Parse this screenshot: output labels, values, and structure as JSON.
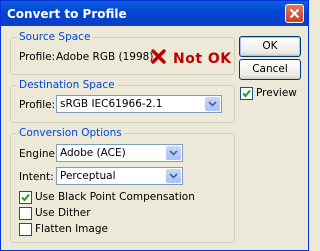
{
  "window": {
    "title": "Convert to Profile"
  },
  "source_space": {
    "legend": "Source Space",
    "profile_label": "Profile:",
    "profile_value": "Adobe RGB (1998)",
    "annotation": "Not OK",
    "annotation_icon": "x-mark-icon",
    "annotation_color": "#c00000"
  },
  "destination_space": {
    "legend": "Destination Space",
    "profile_label": "Profile:",
    "profile_value": "sRGB IEC61966-2.1"
  },
  "conversion_options": {
    "legend": "Conversion Options",
    "engine_label": "Engine:",
    "engine_value": "Adobe (ACE)",
    "intent_label": "Intent:",
    "intent_value": "Perceptual",
    "checkboxes": [
      {
        "label": "Use Black Point Compensation",
        "checked": true
      },
      {
        "label": "Use Dither",
        "checked": false
      },
      {
        "label": "Flatten Image",
        "checked": false
      }
    ]
  },
  "buttons": {
    "ok": "OK",
    "cancel": "Cancel"
  },
  "preview": {
    "label": "Preview",
    "checked": true
  },
  "colors": {
    "titlebar": "#0145d3",
    "legend_text": "#0046d5",
    "dialog_bg": "#ece9d8"
  }
}
